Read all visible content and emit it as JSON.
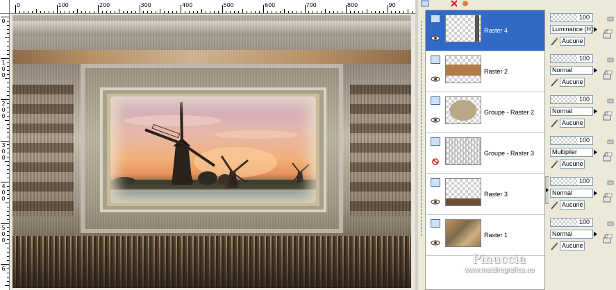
{
  "ruler": {
    "h_labels": [
      "0",
      "100",
      "200",
      "300",
      "400",
      "500",
      "600",
      "700",
      "800",
      "90"
    ],
    "v_labels": [
      [
        "0"
      ],
      [
        "1",
        "0",
        "0"
      ],
      [
        "2",
        "0",
        "0"
      ],
      [
        "3",
        "0",
        "0"
      ],
      [
        "4",
        "0",
        "0"
      ],
      [
        "5",
        "0",
        "0"
      ],
      [
        "6"
      ]
    ]
  },
  "layers": [
    {
      "name": "Raster 4",
      "opacity": "100",
      "blend": "Luminance (H)",
      "group": "Aucune",
      "selected": true,
      "visible": true,
      "thumb": "raster4"
    },
    {
      "name": "Raster 2",
      "opacity": "100",
      "blend": "Normal",
      "group": "Aucune",
      "selected": false,
      "visible": true,
      "thumb": "raster2"
    },
    {
      "name": "Groupe - Raster 2",
      "opacity": "100",
      "blend": "Normal",
      "group": "Aucune",
      "selected": false,
      "visible": true,
      "thumb": "groupe2"
    },
    {
      "name": "Groupe - Raster 3",
      "opacity": "100",
      "blend": "Multiplier",
      "group": "Aucune",
      "selected": false,
      "visible": false,
      "thumb": "groupe3"
    },
    {
      "name": "Raster 3",
      "opacity": "100",
      "blend": "Normal",
      "group": "Aucune",
      "selected": false,
      "visible": true,
      "thumb": "raster3"
    },
    {
      "name": "Raster 1",
      "opacity": "100",
      "blend": "Normal",
      "group": "Aucune",
      "selected": false,
      "visible": true,
      "thumb": "raster1"
    }
  ],
  "watermark": {
    "name": "Pinuccia",
    "url": "www.maidiregrafica.eu"
  },
  "colors": {
    "selection": "#316ac5",
    "panel": "#d4d0c8",
    "canvas": "#e8e6df"
  }
}
